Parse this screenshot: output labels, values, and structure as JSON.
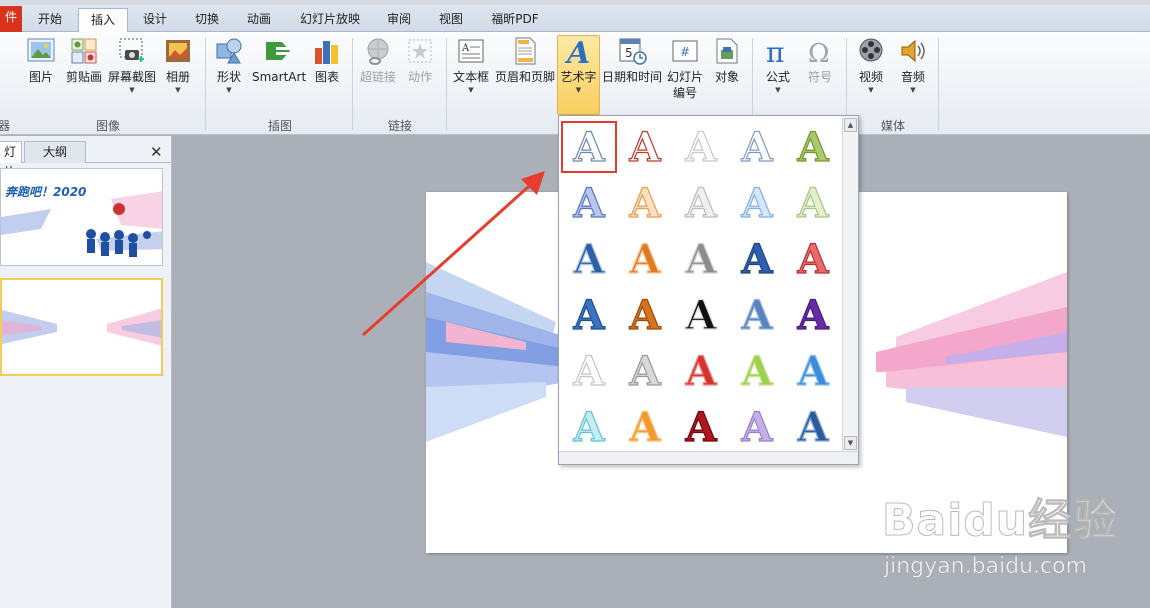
{
  "tabs": {
    "file": "件",
    "home": "开始",
    "insert": "插入",
    "design": "设计",
    "transitions": "切换",
    "animations": "动画",
    "slideshow": "幻灯片放映",
    "review": "审阅",
    "view": "视图",
    "foxit_pdf": "福昕PDF"
  },
  "ribbon": {
    "image_group": {
      "label": "图像",
      "picture": "图片",
      "clipart": "剪贴画",
      "screenshot": "屏幕截图",
      "album": "相册"
    },
    "illustrations_group": {
      "label": "插图",
      "shapes": "形状",
      "smartart": "SmartArt",
      "chart": "图表"
    },
    "links_group": {
      "label": "链接",
      "hyperlink": "超链接",
      "action": "动作"
    },
    "text_group": {
      "textbox": "文本框",
      "header_footer": "页眉和页脚",
      "wordart": "艺术字",
      "datetime": "日期和时间",
      "slide_number_line1": "幻灯片",
      "slide_number_line2": "编号",
      "object": "对象"
    },
    "symbols_group": {
      "equation": "公式",
      "symbol": "符号"
    },
    "media_group": {
      "label": "媒体",
      "video": "视频",
      "audio": "音频"
    },
    "partial_left_label": "器"
  },
  "panel": {
    "tab_slides": "灯片",
    "tab_outline": "大纲",
    "close": "✕",
    "slide1_title": "奔跑吧！2020"
  },
  "gallery": {
    "glyph": "A"
  },
  "watermark": {
    "brand": "Baidu经验",
    "url": "jingyan.baidu.com"
  }
}
